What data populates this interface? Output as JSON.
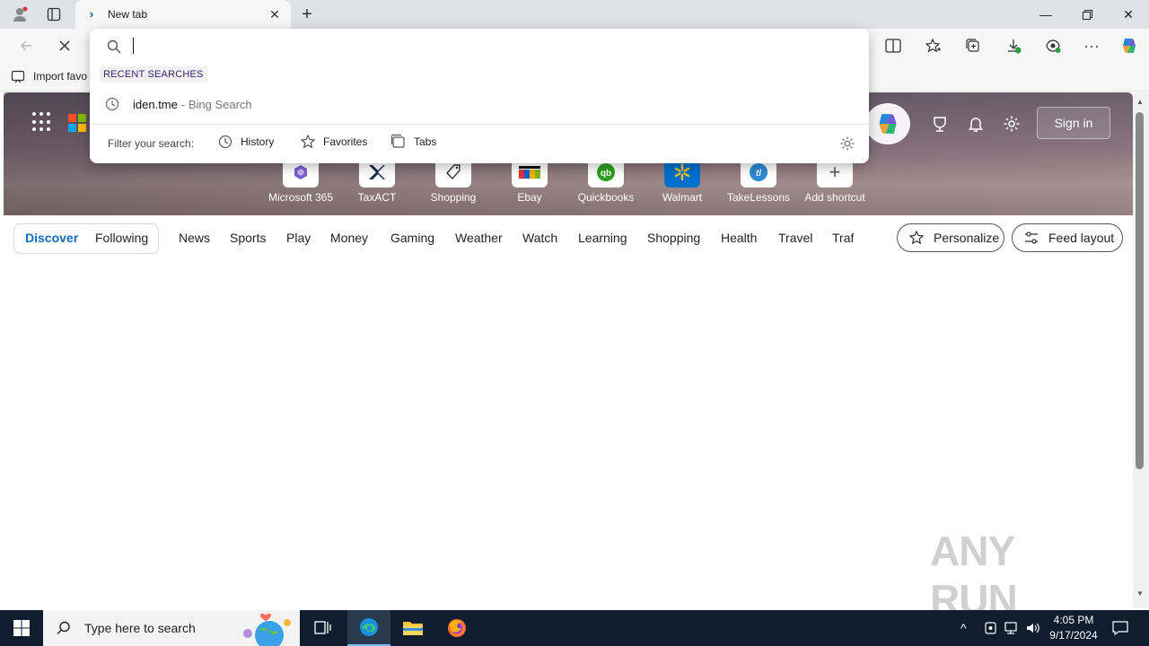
{
  "browser": {
    "tab_title": "New tab",
    "favorites_bar": {
      "import_label": "Import favo"
    }
  },
  "dropdown": {
    "placeholder": "",
    "recent_label": "RECENT SEARCHES",
    "recent_items": [
      {
        "query": "iden.tme",
        "suffix": "- Bing Search"
      }
    ],
    "filter_label": "Filter your search:",
    "filters": [
      {
        "label": "History",
        "icon": "history-icon"
      },
      {
        "label": "Favorites",
        "icon": "star-icon"
      },
      {
        "label": "Tabs",
        "icon": "tabs-icon"
      }
    ]
  },
  "hero": {
    "signin_label": "Sign in",
    "shortcuts": [
      {
        "label": "Microsoft 365",
        "color": "#7b5cd6"
      },
      {
        "label": "TaxACT",
        "color": "#15294b"
      },
      {
        "label": "Shopping",
        "color": "#333333"
      },
      {
        "label": "Ebay",
        "color": "#e53238"
      },
      {
        "label": "Quickbooks",
        "color": "#2ca01c"
      },
      {
        "label": "Walmart",
        "color": "#0071ce"
      },
      {
        "label": "TakeLessons",
        "color": "#2d8bd4"
      },
      {
        "label": "Add shortcut",
        "color": "#777777"
      }
    ]
  },
  "feed_nav": {
    "primary": [
      "Discover",
      "Following"
    ],
    "categories": [
      "News",
      "Sports",
      "Play",
      "Money",
      "Gaming",
      "Weather",
      "Watch",
      "Learning",
      "Shopping",
      "Health",
      "Travel",
      "Traf"
    ],
    "personalize_label": "Personalize",
    "feed_layout_label": "Feed layout"
  },
  "taskbar": {
    "search_placeholder": "Type here to search",
    "time": "4:05 PM",
    "date": "9/17/2024"
  },
  "watermark": "ANY RUN",
  "colors": {
    "accent": "#0f6cbd",
    "taskbar": "#0f1d2e",
    "recent_label_text": "#38266f"
  }
}
